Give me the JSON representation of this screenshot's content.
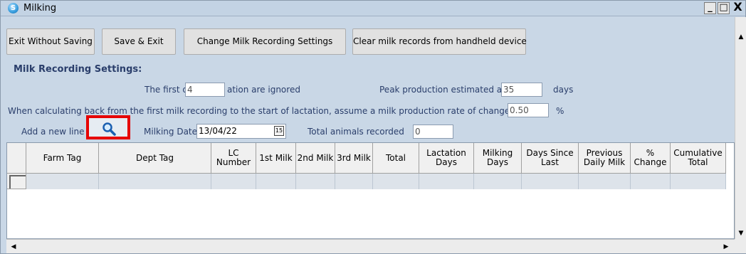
{
  "window": {
    "title": "Milking",
    "min": "_",
    "max": "□",
    "close": "X"
  },
  "toolbar": {
    "exit_without_saving": "Exit Without Saving",
    "save_exit": "Save & Exit",
    "change_settings": "Change Milk Recording Settings",
    "clear_records": "Clear milk records from handheld device"
  },
  "settings": {
    "heading": "Milk Recording Settings:",
    "first_days_prefix": "The first d",
    "first_days_value": "4",
    "first_days_suffix": "ation are ignored",
    "peak_label": "Peak production estimated at",
    "peak_value": "35",
    "peak_unit": "days",
    "rate_label": "When calculating back from the first milk recording to the start of lactation, assume a milk production rate of change per day",
    "rate_value": "0.50",
    "rate_unit": "%"
  },
  "entry": {
    "add_line_label": "Add a new line",
    "milking_date_label": "Milking Date",
    "milking_date_value": "13/04/22",
    "calendar_glyph": "15",
    "total_animals_label": "Total animals recorded",
    "total_animals_value": "0"
  },
  "grid": {
    "columns": [
      "",
      "Farm Tag",
      "Dept Tag",
      "LC Number",
      "1st Milk",
      "2nd Milk",
      "3rd Milk",
      "Total",
      "Lactation Days",
      "Milking Days",
      "Days Since Last",
      "Previous Daily Milk",
      "% Change",
      "Cumulative Total"
    ]
  },
  "icons": {
    "search": "search-icon",
    "calendar": "calendar-icon"
  },
  "colors": {
    "window_bg": "#c9d7e6",
    "highlight_border": "#e60000",
    "label_blue": "#2a3e6b"
  }
}
